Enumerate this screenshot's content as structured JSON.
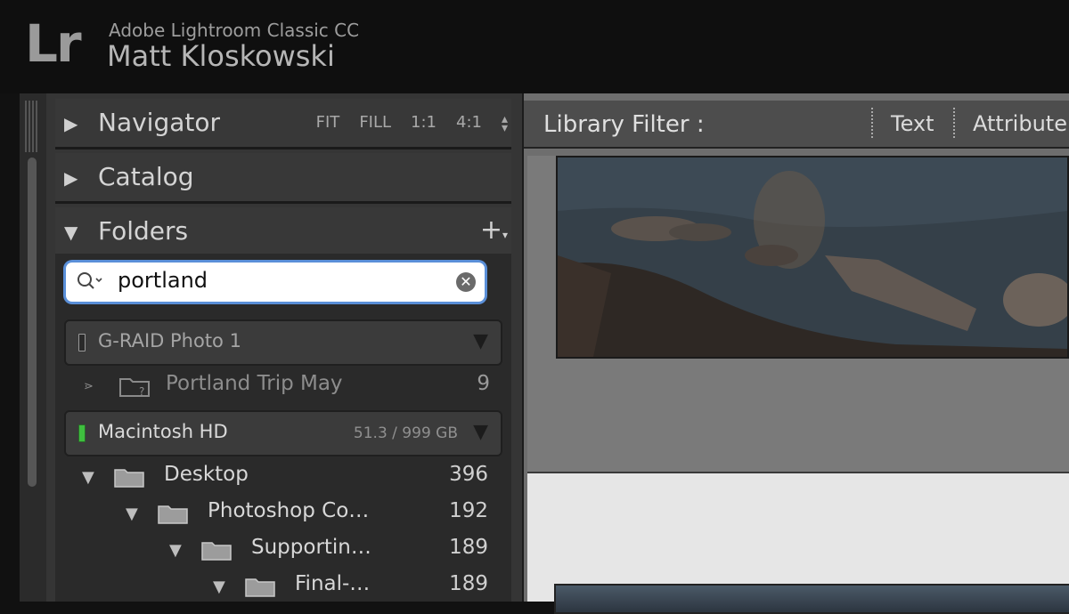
{
  "titlebar": {
    "logo": "Lr",
    "app_name": "Adobe Lightroom Classic CC",
    "user_name": "Matt Kloskowski"
  },
  "left_panel": {
    "navigator": {
      "title": "Navigator",
      "zoom_options": [
        "FIT",
        "FILL",
        "1:1",
        "4:1"
      ]
    },
    "catalog": {
      "title": "Catalog"
    },
    "folders": {
      "title": "Folders",
      "search_value": "portland",
      "volumes": [
        {
          "name": "G-RAID Photo 1",
          "size": "",
          "led_color": "#2a2a2a"
        },
        {
          "name": "Macintosh HD",
          "size": "51.3 / 999 GB",
          "led_color": "#3fbf3f"
        }
      ],
      "offline_folder": {
        "name": "Portland Trip May",
        "count": "9"
      },
      "tree": [
        {
          "name": "Desktop",
          "count": "396"
        },
        {
          "name": "Photoshop Co…",
          "count": "192"
        },
        {
          "name": "Supportin…",
          "count": "189"
        },
        {
          "name": "Final-…",
          "count": "189"
        }
      ]
    }
  },
  "library_filter": {
    "label": "Library Filter :",
    "options": [
      "Text",
      "Attribute"
    ]
  }
}
